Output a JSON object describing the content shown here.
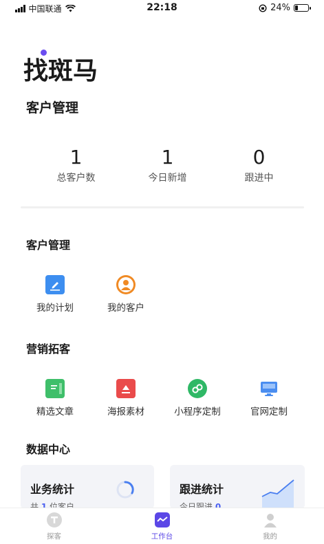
{
  "status": {
    "carrier": "中国联通",
    "time": "22:18",
    "battery": "24%",
    "battery_level": 0.24
  },
  "brand": {
    "logo": "找斑马",
    "accent": "#6b4df0"
  },
  "page_title": "客户管理",
  "stats": [
    {
      "value": "1",
      "label": "总客户数"
    },
    {
      "value": "1",
      "label": "今日新增"
    },
    {
      "value": "0",
      "label": "跟进中"
    }
  ],
  "customer_section": {
    "title": "客户管理",
    "items": [
      {
        "label": "我的计划",
        "icon": "edit-icon"
      },
      {
        "label": "我的客户",
        "icon": "person-icon"
      }
    ]
  },
  "marketing_section": {
    "title": "营销拓客",
    "items": [
      {
        "label": "精选文章",
        "icon": "article-icon"
      },
      {
        "label": "海报素材",
        "icon": "poster-icon"
      },
      {
        "label": "小程序定制",
        "icon": "mini-program-icon"
      },
      {
        "label": "官网定制",
        "icon": "website-icon"
      }
    ]
  },
  "data_section": {
    "title": "数据中心",
    "cards": [
      {
        "title": "业务统计",
        "sub_prefix": "共",
        "sub_value": "1",
        "sub_suffix": "位客户"
      },
      {
        "title": "跟进统计",
        "sub_prefix": "今日跟进",
        "sub_value": "0"
      }
    ]
  },
  "tabbar": [
    {
      "label": "探客",
      "icon": "explore-icon",
      "active": false
    },
    {
      "label": "工作台",
      "icon": "workbench-icon",
      "active": true
    },
    {
      "label": "我的",
      "icon": "profile-icon",
      "active": false
    }
  ]
}
